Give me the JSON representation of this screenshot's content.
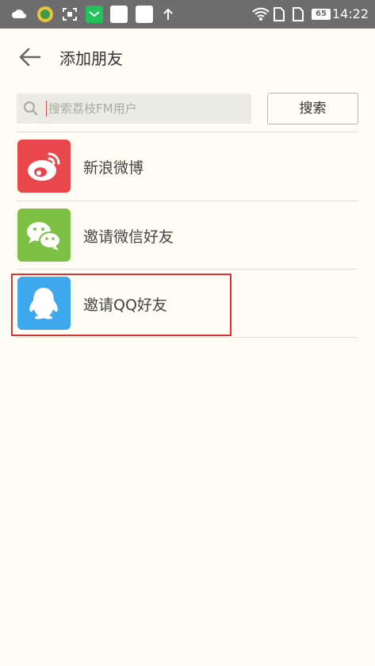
{
  "status_bar": {
    "time": "14:22",
    "battery": "65",
    "icons": [
      "cloud-icon",
      "app-icon",
      "screenshot-icon",
      "message-icon",
      "blank-icon",
      "blank-icon",
      "upload-icon",
      "wifi-icon",
      "sim-icon",
      "sim-icon",
      "battery-icon"
    ]
  },
  "header": {
    "title": "添加朋友"
  },
  "search": {
    "placeholder": "搜索荔枝FM用户",
    "value": "",
    "button_label": "搜索"
  },
  "list": {
    "items": [
      {
        "label": "新浪微博",
        "icon": "weibo-icon",
        "color": "#e8474b"
      },
      {
        "label": "邀请微信好友",
        "icon": "wechat-icon",
        "color": "#7cc143"
      },
      {
        "label": "邀请QQ好友",
        "icon": "qq-icon",
        "color": "#3ea8ef"
      }
    ]
  },
  "highlight_color": "#d93333"
}
